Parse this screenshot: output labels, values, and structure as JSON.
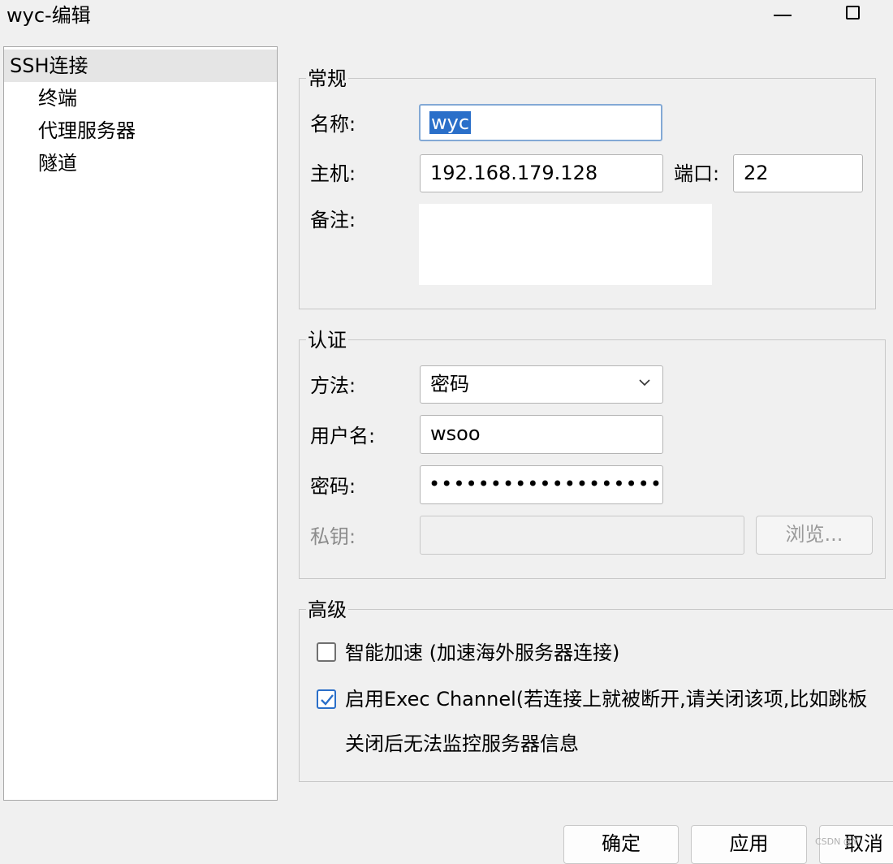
{
  "window": {
    "title": "wyc-编辑"
  },
  "tree": {
    "items": [
      "SSH连接",
      "终端",
      "代理服务器",
      "隧道"
    ]
  },
  "general": {
    "legend": "常规",
    "name_label": "名称:",
    "name_value": "wyc",
    "host_label": "主机:",
    "host_value": "192.168.179.128",
    "port_label": "端口:",
    "port_value": "22",
    "note_label": "备注:"
  },
  "auth": {
    "legend": "认证",
    "method_label": "方法:",
    "method_value": "密码",
    "username_label": "用户名:",
    "username_value": "wsoo",
    "password_label": "密码:",
    "password_mask": "•••••••••••••••••••••••",
    "private_key_label": "私钥:",
    "browse_label": "浏览..."
  },
  "advanced": {
    "legend": "高级",
    "smart_accel_label": "智能加速 (加速海外服务器连接)",
    "smart_accel_checked": false,
    "exec_channel_label": "启用Exec Channel(若连接上就被断开,请关闭该项,比如跳板",
    "exec_channel_checked": true,
    "exec_channel_note": "关闭后无法监控服务器信息"
  },
  "footer": {
    "ok_label": "确定",
    "apply_label": "应用",
    "cancel_label": "取消"
  },
  "watermark": "CSDN @Y"
}
